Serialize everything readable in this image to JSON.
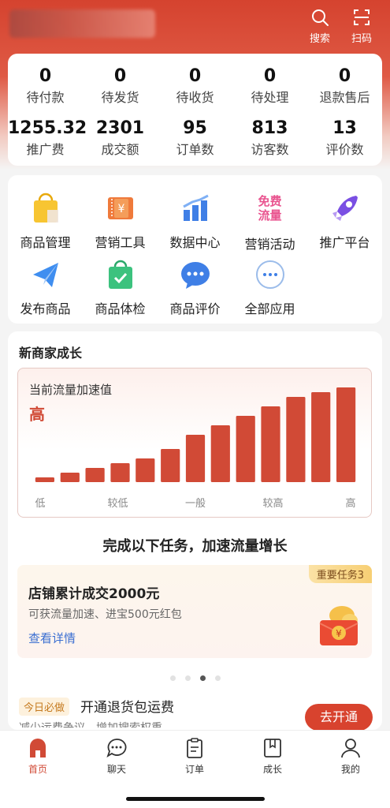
{
  "header": {
    "search_label": "搜索",
    "scan_label": "扫码"
  },
  "stats": {
    "row1": [
      {
        "value": "0",
        "label": "待付款"
      },
      {
        "value": "0",
        "label": "待发货"
      },
      {
        "value": "0",
        "label": "待收货"
      },
      {
        "value": "0",
        "label": "待处理"
      },
      {
        "value": "0",
        "label": "退款售后"
      }
    ],
    "row2": [
      {
        "value": "1255.32",
        "label": "推广费"
      },
      {
        "value": "2301",
        "label": "成交额"
      },
      {
        "value": "95",
        "label": "订单数"
      },
      {
        "value": "813",
        "label": "访客数"
      },
      {
        "value": "13",
        "label": "评价数"
      }
    ]
  },
  "tools": {
    "items": [
      {
        "label": "商品管理",
        "icon": "shopping-bag-icon"
      },
      {
        "label": "营销工具",
        "icon": "coupon-ticket-icon"
      },
      {
        "label": "数据中心",
        "icon": "bar-chart-icon"
      },
      {
        "label": "营销活动",
        "icon": "free-traffic-icon",
        "icon_text": "免费流量"
      },
      {
        "label": "推广平台",
        "icon": "rocket-icon"
      },
      {
        "label": "发布商品",
        "icon": "paper-plane-icon"
      },
      {
        "label": "商品体检",
        "icon": "check-bag-icon"
      },
      {
        "label": "商品评价",
        "icon": "chat-bubble-icon"
      },
      {
        "label": "全部应用",
        "icon": "more-apps-icon"
      }
    ]
  },
  "growth": {
    "title": "新商家成长",
    "chart_title": "当前流量加速值",
    "current_level": "高",
    "task_heading": "完成以下任务，加速流量增长",
    "task": {
      "badge": "重要任务3",
      "title": "店铺累计成交2000元",
      "desc": "可获流量加速、进宝500元红包",
      "link": "查看详情"
    },
    "carousel": {
      "count": 4,
      "active": 3
    },
    "today": {
      "tag": "今日必做",
      "title": "开通退货包运费",
      "desc": "减少运费争议，增加搜索权重",
      "button": "去开通"
    }
  },
  "chart_data": {
    "type": "bar",
    "title": "当前流量加速值",
    "xlabel": "",
    "ylabel": "",
    "x_tick_labels": [
      "低",
      "较低",
      "一般",
      "较高",
      "高"
    ],
    "values": [
      5,
      10,
      15,
      20,
      25,
      35,
      50,
      60,
      70,
      80,
      90,
      95,
      100
    ],
    "ylim": [
      0,
      100
    ],
    "grid": false,
    "color": "#d14a36"
  },
  "tabbar": {
    "tabs": [
      {
        "label": "首页",
        "icon": "home-icon",
        "active": true
      },
      {
        "label": "聊天",
        "icon": "chat-icon",
        "active": false
      },
      {
        "label": "订单",
        "icon": "order-icon",
        "active": false
      },
      {
        "label": "成长",
        "icon": "growth-book-icon",
        "active": false
      },
      {
        "label": "我的",
        "icon": "profile-icon",
        "active": false
      }
    ]
  },
  "colors": {
    "brand_red": "#d14a36",
    "link_blue": "#3b6fd1"
  }
}
